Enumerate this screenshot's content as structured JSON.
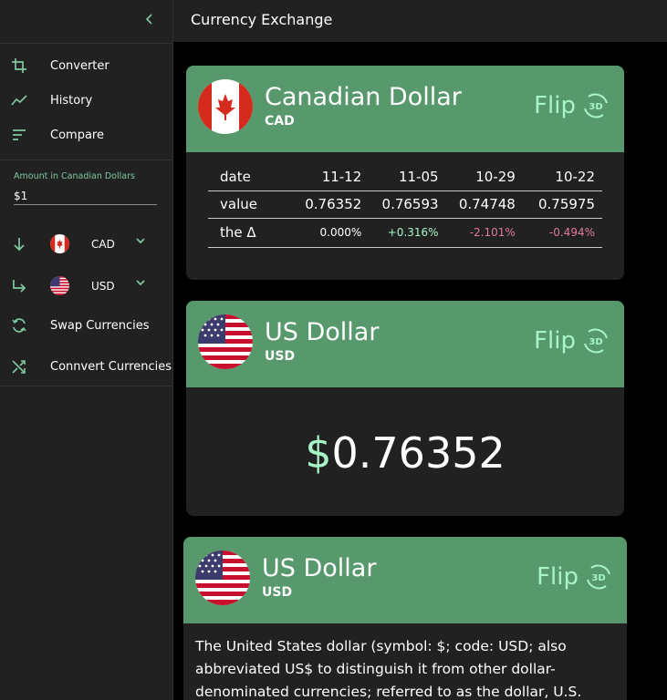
{
  "header": {
    "title": "Currency Exchange"
  },
  "sidebar": {
    "nav": [
      {
        "label": "Converter",
        "icon": "crop-icon"
      },
      {
        "label": "History",
        "icon": "trend-icon"
      },
      {
        "label": "Compare",
        "icon": "sort-icon"
      }
    ],
    "amount": {
      "label": "Amount in Canadian Dollars",
      "value": "$1"
    },
    "from_currency": {
      "code": "CAD"
    },
    "to_currency": {
      "code": "USD"
    },
    "actions": [
      {
        "label": "Swap Currencies"
      },
      {
        "label": "Connvert Currencies"
      }
    ]
  },
  "cards": [
    {
      "name": "Canadian Dollar",
      "code": "CAD",
      "flip_label": "Flip",
      "flip_badge": "3D",
      "table": {
        "rows": [
          {
            "label": "date",
            "values": [
              "11-12",
              "11-05",
              "10-29",
              "10-22"
            ]
          },
          {
            "label": "value",
            "values": [
              "0.76352",
              "0.76593",
              "0.74748",
              "0.75975"
            ]
          },
          {
            "label": "the Δ",
            "values": [
              "0.000%",
              "+0.316%",
              "-2.101%",
              "-0.494%"
            ]
          }
        ]
      }
    },
    {
      "name": "US Dollar",
      "code": "USD",
      "flip_label": "Flip",
      "flip_badge": "3D",
      "symbol": "$",
      "amount": "0.76352"
    },
    {
      "name": "US Dollar",
      "code": "USD",
      "flip_label": "Flip",
      "flip_badge": "3D",
      "description": "The United States dollar (symbol: $; code: USD; also abbreviated US$ to distinguish it from other dollar-denominated currencies; referred to as the dollar, U.S. dollar, or American"
    }
  ],
  "colors": {
    "accent": "#7fc8a0",
    "card_header": "#57986d",
    "positive": "#a8f5c6",
    "negative": "#e07a9e"
  }
}
